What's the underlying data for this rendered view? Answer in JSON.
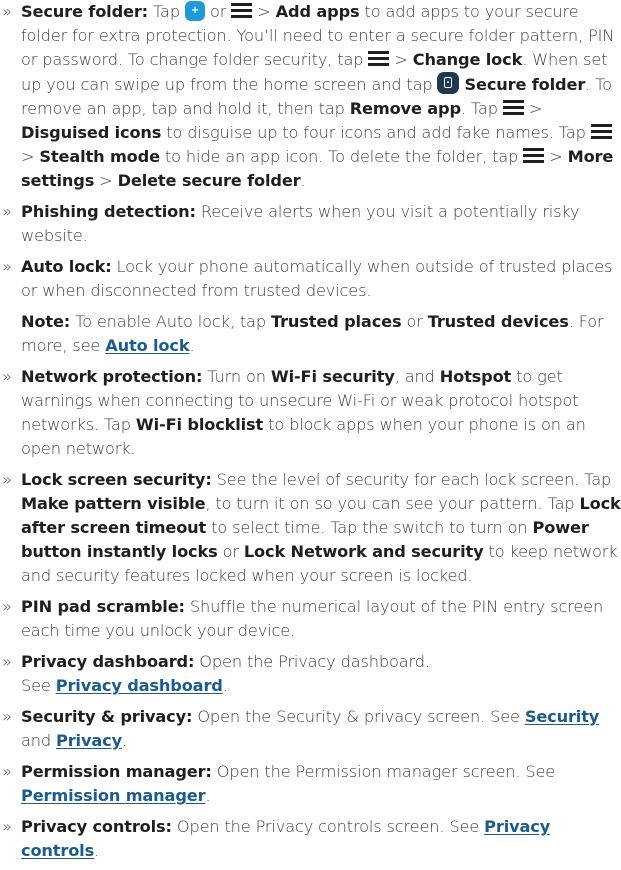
{
  "secure_folder": {
    "term": "Secure folder:",
    "t1": " Tap ",
    "t2": " or ",
    "t3": " > ",
    "add_apps": "Add apps",
    "t4": " to add apps to your secure folder for extra protection. You’ll need to enter a secure folder pattern, PIN or password. To change folder security, tap ",
    "t5": " > ",
    "change_lock": "Change lock",
    "t6": ". When set up you can swipe up from the home screen and tap ",
    "secure_folder_name": "Secure folder",
    "t7": ". To remove an app, tap and hold it, then tap ",
    "remove_app": "Remove app",
    "t8": ". Tap ",
    "t9": " > ",
    "disguised_icons": "Disguised icons",
    "t10": " to disguise up to four icons and add fake names. Tap ",
    "t11": " > ",
    "stealth_mode": "Stealth mode",
    "t12": " to hide an app icon. To delete the folder, tap ",
    "t13": " > ",
    "more_settings": "More settings",
    "t14": " > ",
    "delete_secure_folder": "Delete secure folder",
    "t15": "."
  },
  "phishing": {
    "term": "Phishing detection:",
    "t1": " Receive alerts when you visit a potentially risky website."
  },
  "auto_lock": {
    "term": "Auto lock:",
    "t1": " Lock your phone automatically when outside of trusted places or when disconnected from trusted devices."
  },
  "note": {
    "term": "Note:",
    "t1": " To enable Auto lock, tap ",
    "trusted_places": "Trusted places",
    "t2": " or ",
    "trusted_devices": "Trusted devices",
    "t3": ". For more, see ",
    "link": "Auto lock",
    "t4": "."
  },
  "network": {
    "term": "Network protection:",
    "t1": " Turn on ",
    "wifi_security": "Wi-Fi security",
    "t2": ", and ",
    "hotspot": "Hotspot",
    "t3": " to get warnings when connecting to unsecure Wi-Fi or weak protocol hotspot networks. Tap ",
    "wifi_blocklist": "Wi-Fi blocklist",
    "t4": " to block apps when your phone is on an open network."
  },
  "lock_screen": {
    "term": "Lock screen security:",
    "t1": " See the level of security for each lock screen. Tap ",
    "make_pattern_visible": "Make pattern visible",
    "t2": ", to turn it on so you can see your pattern. Tap ",
    "lock_after_timeout": "Lock after screen timeout",
    "t3": " to select time. Tap the switch to turn on ",
    "power_button": "Power button instantly locks",
    "t4": " or ",
    "lock_network": "Lock Network and security",
    "t5": " to keep network and security features locked when your screen is locked."
  },
  "pin_pad": {
    "term": "PIN pad scramble:",
    "t1": " Shuffle the numerical layout of the PIN entry screen each time you unlock your device."
  },
  "privacy_dashboard": {
    "term": "Privacy dashboard:",
    "t1": " Open the Privacy dashboard.",
    "t2": "See ",
    "link": "Privacy dashboard",
    "t3": "."
  },
  "security_privacy": {
    "term": "Security & privacy:",
    "t1": " Open the Security & privacy screen. See ",
    "link1": "Security",
    "t2": " and ",
    "link2": "Privacy",
    "t3": "."
  },
  "permission_manager": {
    "term": "Permission manager:",
    "t1": " Open the Permission manager screen. See ",
    "link": "Permission manager",
    "t2": "."
  },
  "privacy_controls": {
    "term": "Privacy controls:",
    "t1": " Open the Privacy controls screen. See ",
    "link": "Privacy controls",
    "t2": "."
  },
  "bullet": "»"
}
